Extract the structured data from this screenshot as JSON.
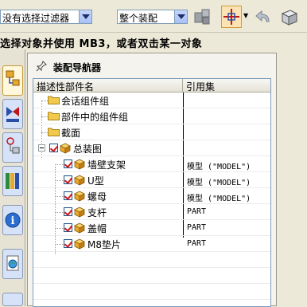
{
  "toolbar": {
    "filter_select": "没有选择过滤器",
    "assembly_select": "整个装配"
  },
  "status_line": "选择对象并使用 MB3，或者双击某一对象",
  "navigator": {
    "title": "装配导航器",
    "columns": [
      "描述性部件名",
      "引用集"
    ],
    "rows": [
      {
        "name": "会话组件组",
        "ref": ""
      },
      {
        "name": "部件中的组件组",
        "ref": ""
      },
      {
        "name": "截面",
        "ref": ""
      },
      {
        "name": "总装图",
        "ref": ""
      },
      {
        "name": "墙壁支架",
        "ref": "模型 (\"MODEL\")"
      },
      {
        "name": "U型",
        "ref": "模型 (\"MODEL\")"
      },
      {
        "name": "螺母",
        "ref": "模型 (\"MODEL\")"
      },
      {
        "name": "支杆",
        "ref": "PART"
      },
      {
        "name": "盖帽",
        "ref": "PART"
      },
      {
        "name": "M8垫片",
        "ref": "PART"
      }
    ]
  },
  "colors": {
    "checkmark": "#d2161b",
    "part_cube": "#e8a92a",
    "folder": "#f2c94c"
  }
}
